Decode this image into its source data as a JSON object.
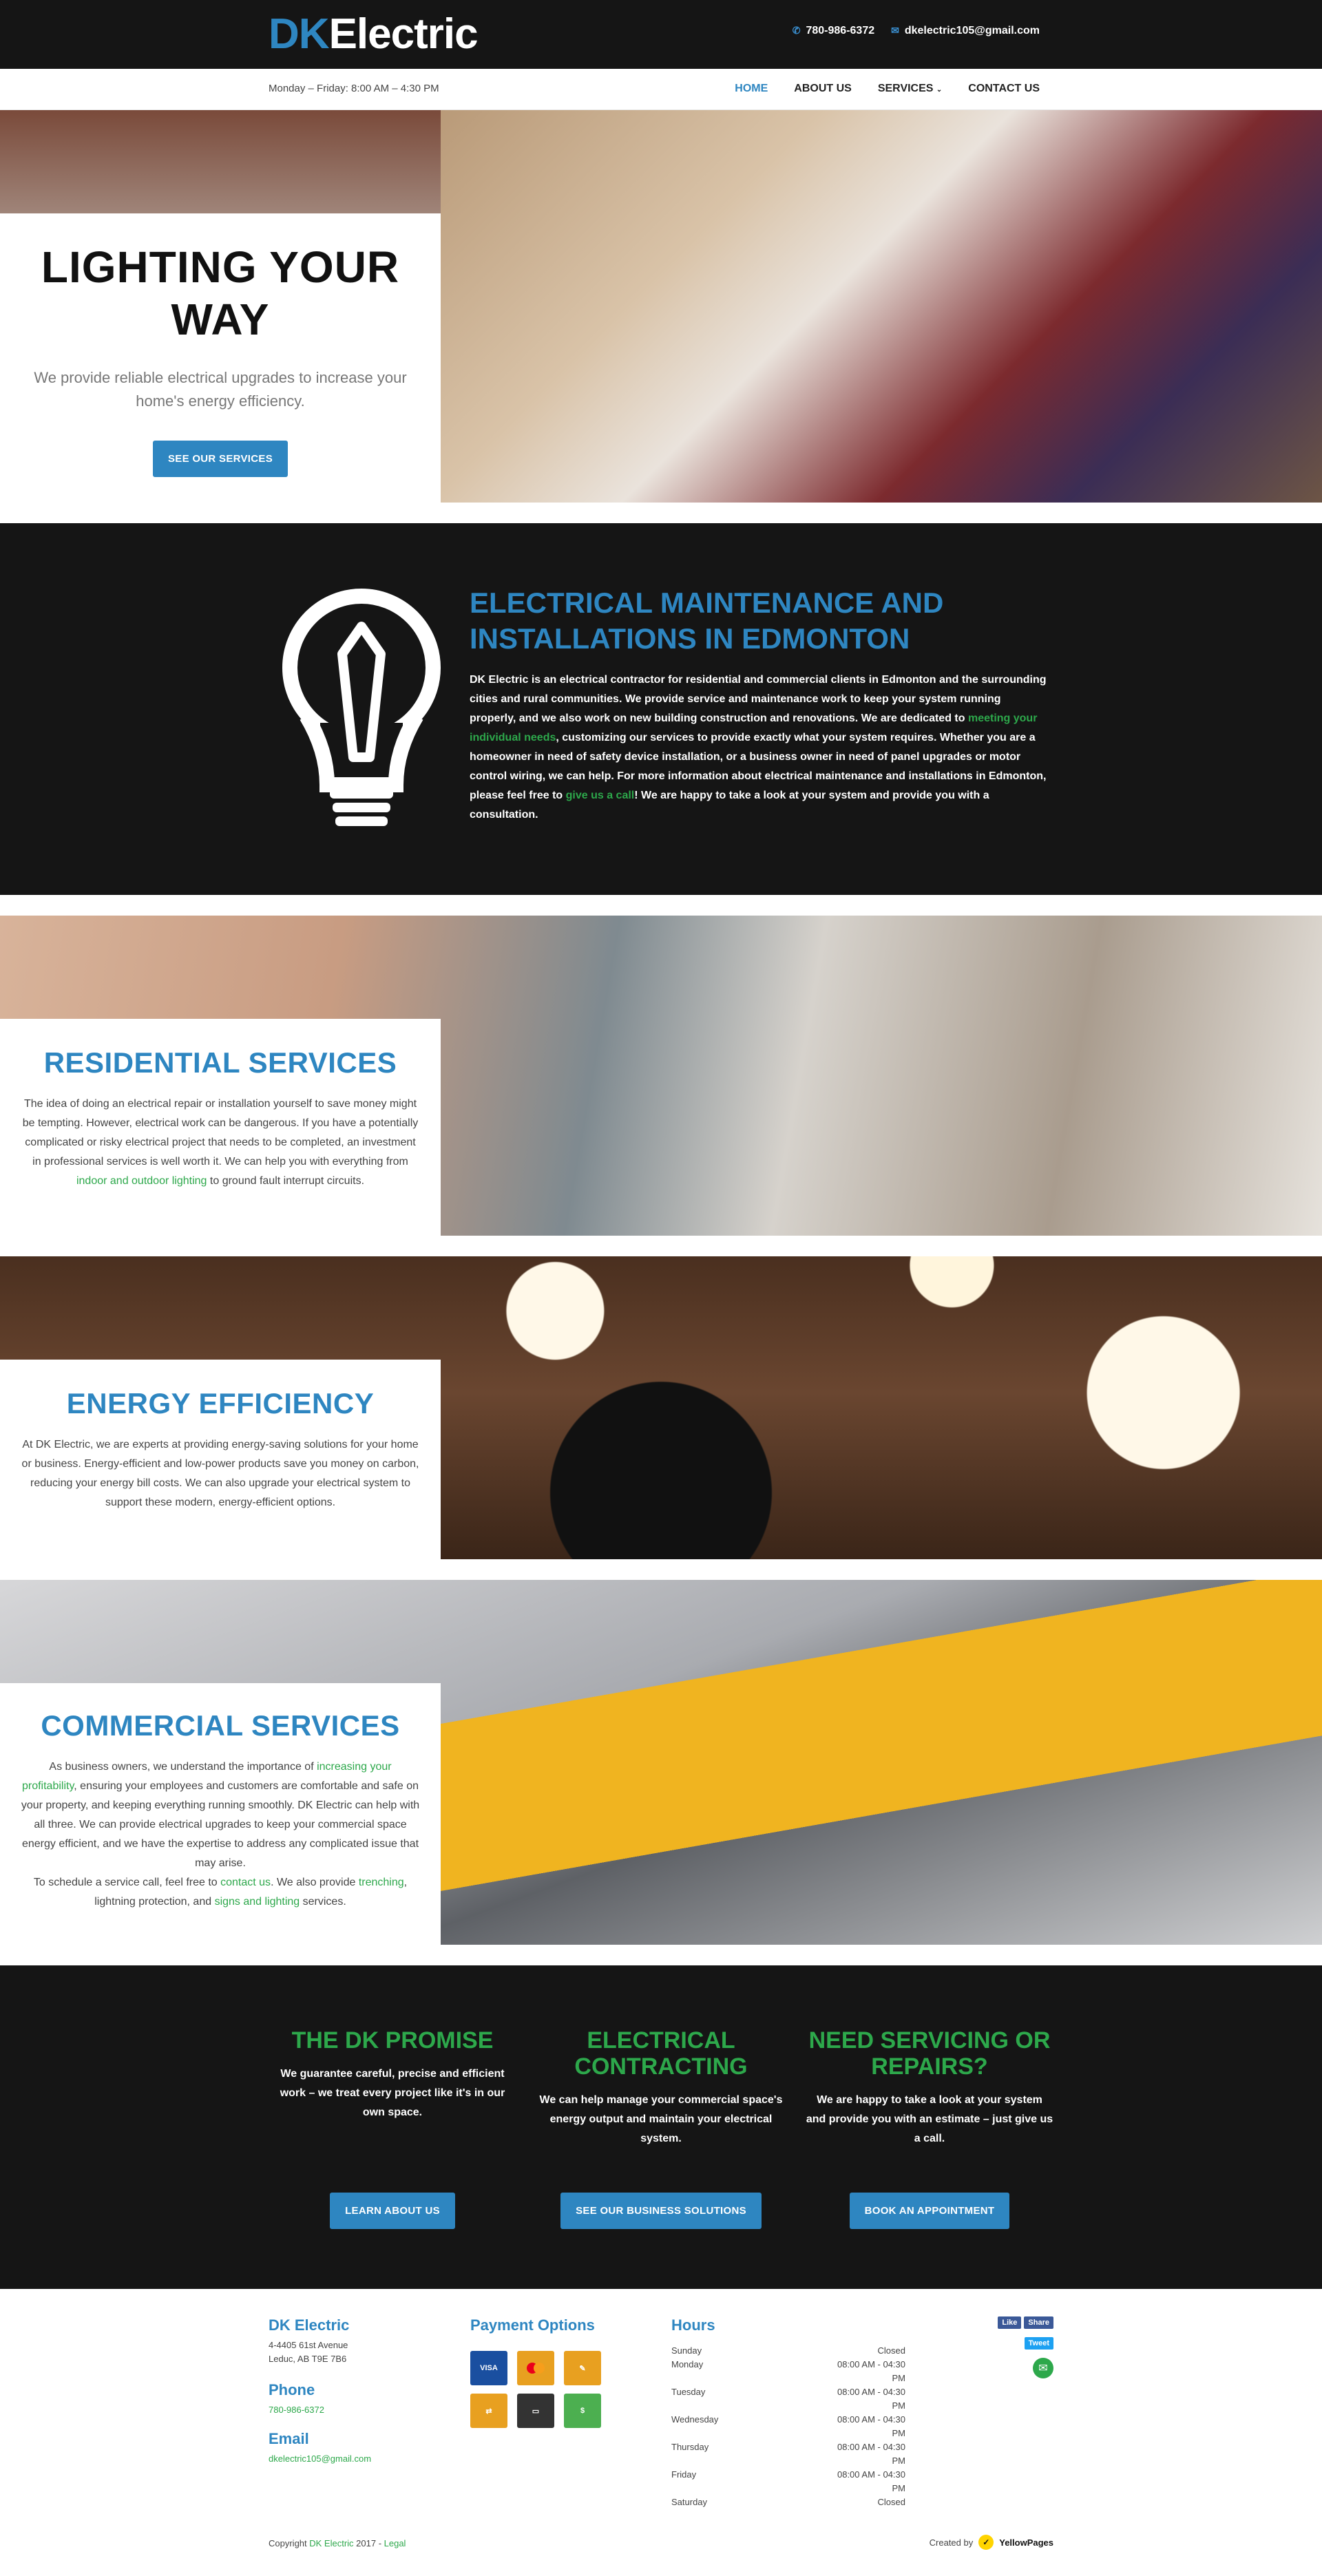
{
  "header": {
    "logo_dk": "DK",
    "logo_rest": "Electric",
    "phone": "780-986-6372",
    "email": "dkelectric105@gmail.com",
    "hours": "Monday – Friday: 8:00 AM – 4:30 PM",
    "nav": [
      "HOME",
      "ABOUT US",
      "SERVICES",
      "CONTACT US"
    ]
  },
  "hero": {
    "title": "LIGHTING YOUR WAY",
    "subtitle": "We provide reliable electrical upgrades to increase your home's energy efficiency.",
    "button": "SEE OUR SERVICES"
  },
  "about": {
    "title": "ELECTRICAL MAINTENANCE AND INSTALLATIONS IN EDMONTON",
    "p1": "DK Electric is an electrical contractor for residential and commercial clients in Edmonton and the surrounding cities and rural communities. We provide service and maintenance work to keep your system running properly, and we also work on new building construction and renovations. We are dedicated to ",
    "link1": "meeting your individual needs",
    "p2": ", customizing our services to provide exactly what your system requires. Whether you are a homeowner in need of safety device installation, or a business owner in need of panel upgrades or motor control wiring, we can help. For more information about electrical maintenance and installations in Edmonton, please feel free to ",
    "link2": "give us a call",
    "p3": "! We are happy to take a look at your system and provide you with a consultation."
  },
  "residential": {
    "title": "RESIDENTIAL SERVICES",
    "text1": "The idea of doing an electrical repair or installation yourself to save money might be tempting. However, electrical work can be dangerous. If you have a potentially complicated or risky electrical project that needs to be completed, an investment in professional services is well worth it. We can help you with everything from ",
    "link": "indoor and outdoor lighting",
    "text2": " to ground fault interrupt circuits."
  },
  "energy": {
    "title": "ENERGY EFFICIENCY",
    "text": "At DK Electric, we are experts at providing energy-saving solutions for your home or business. Energy-efficient and low-power products save you money on carbon, reducing your energy bill costs. We can also upgrade your electrical system to support these modern, energy-efficient options."
  },
  "commercial": {
    "title": "COMMERCIAL SERVICES",
    "a1": "As business owners, we understand the importance of ",
    "link1": "increasing your profitability",
    "a2": ", ensuring your employees and customers are comfortable and safe on your property, and keeping everything running smoothly. DK Electric can help with all three. We can provide electrical upgrades to keep your commercial space energy efficient, and we have the expertise to address any complicated issue that may arise.",
    "b1": "To schedule a service call, feel free to ",
    "link2": "contact us",
    "b2": ". We also provide ",
    "link3": "trenching",
    "b3": ", lightning protection, and ",
    "link4": "signs and lighting",
    "b4": " services."
  },
  "promise": {
    "cols": [
      {
        "title": "THE DK PROMISE",
        "text": "We guarantee careful, precise and efficient work – we treat every project like it's in our own space.",
        "button": "LEARN ABOUT US"
      },
      {
        "title": "ELECTRICAL CONTRACTING",
        "text": "We can help manage your commercial space's energy output and maintain your electrical system.",
        "button": "SEE OUR BUSINESS SOLUTIONS"
      },
      {
        "title": "NEED SERVICING OR REPAIRS?",
        "text": "We are happy to take a look at your system and provide you with an estimate – just give us a call.",
        "button": "BOOK AN APPOINTMENT"
      }
    ]
  },
  "footer": {
    "company": "DK Electric",
    "address1": "4-4405 61st Avenue",
    "address2": "Leduc, AB T9E 7B6",
    "phone_h": "Phone",
    "phone": "780-986-6372",
    "email_h": "Email",
    "email": "dkelectric105@gmail.com",
    "payment_h": "Payment Options",
    "payment": [
      "VISA",
      "MasterCard",
      "Cheque",
      "E-Transfer",
      "Debit",
      "Cash"
    ],
    "hours_h": "Hours",
    "hours": [
      [
        "Sunday",
        "Closed"
      ],
      [
        "Monday",
        "08:00 AM - 04:30 PM"
      ],
      [
        "Tuesday",
        "08:00 AM - 04:30 PM"
      ],
      [
        "Wednesday",
        "08:00 AM - 04:30 PM"
      ],
      [
        "Thursday",
        "08:00 AM - 04:30 PM"
      ],
      [
        "Friday",
        "08:00 AM - 04:30 PM"
      ],
      [
        "Saturday",
        "Closed"
      ]
    ],
    "social": [
      "Like",
      "Share",
      "Tweet"
    ],
    "copy_pre": "Copyright ",
    "copy_link": "DK Electric",
    "copy_mid": " 2017 - ",
    "copy_legal": "Legal",
    "created": "Created by",
    "yp": "YellowPages"
  },
  "colors": {
    "blue": "#2e86c1",
    "green": "#2da84b",
    "dark": "#151515"
  }
}
